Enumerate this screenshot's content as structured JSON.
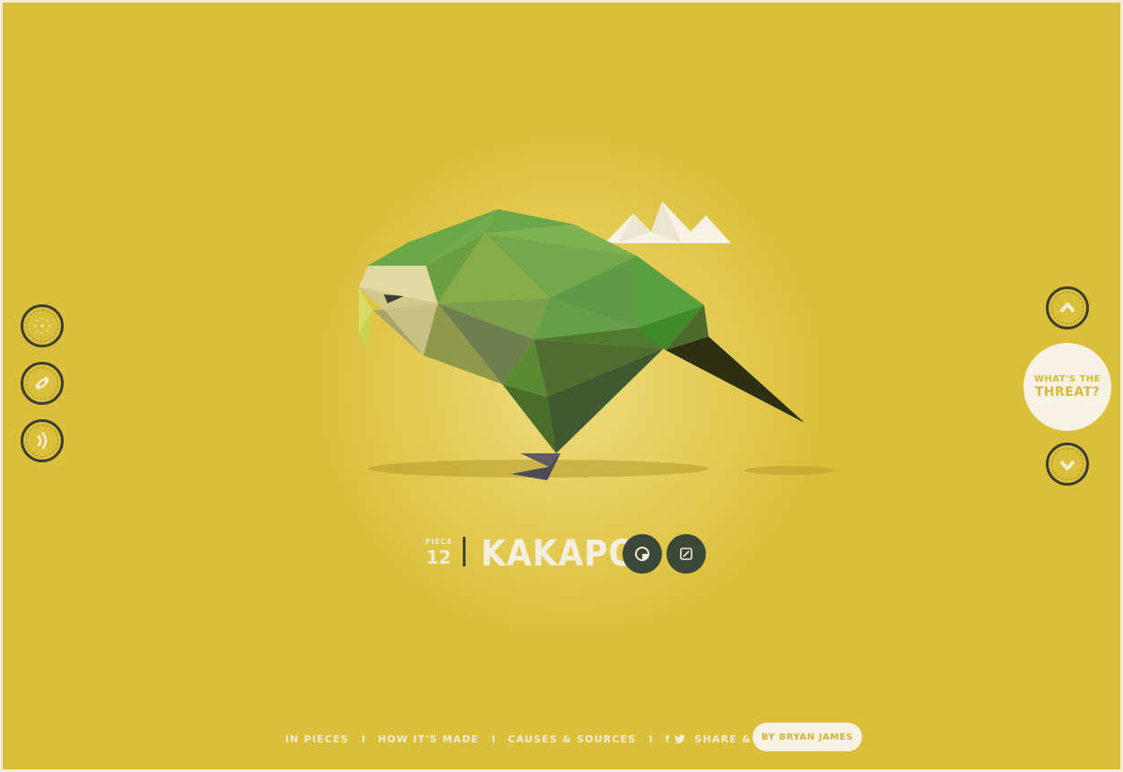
{
  "left_controls": [
    {
      "name": "explode-pieces-button",
      "icon": "dots-circle-icon"
    },
    {
      "name": "shuffle-button",
      "icon": "shuffle-arrows-icon"
    },
    {
      "name": "sound-button",
      "icon": "sound-waves-icon"
    }
  ],
  "right_controls": {
    "up_icon": "chevron-up-icon",
    "down_icon": "chevron-down-icon",
    "threat_line1": "WHAT'S THE",
    "threat_line2": "THREAT?"
  },
  "title": {
    "piece_label": "PIECE",
    "piece_number": "12",
    "species": "KAKAPO",
    "stats_icon": "pie-chart-icon",
    "edit_icon": "pencil-square-icon"
  },
  "footer": {
    "links": [
      "IN PIECES",
      "HOW IT'S MADE",
      "CAUSES & SOURCES"
    ],
    "separator": "I",
    "facebook_icon": "f",
    "share_label": "SHARE & POSTER",
    "byline": "BY BRYAN JAMES"
  },
  "colors": {
    "background": "#dbbf3b",
    "ring": "#3b3d30",
    "cream": "#f4efdc",
    "dark_button": "#3a4739"
  }
}
